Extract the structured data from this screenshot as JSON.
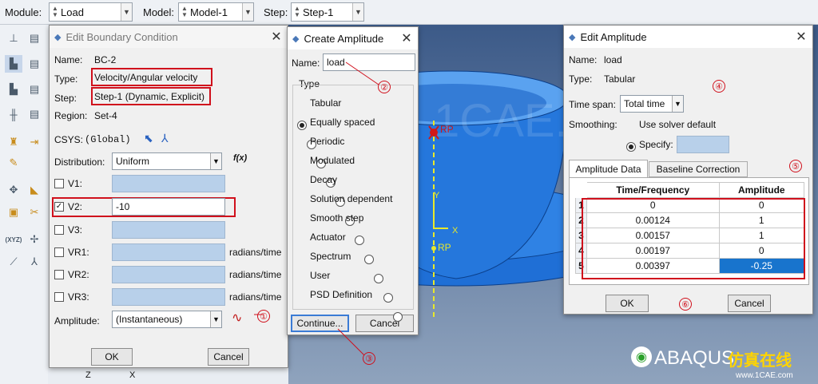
{
  "topbar": {
    "module_label": "Module:",
    "module_value": "Load",
    "model_label": "Model:",
    "model_value": "Model-1",
    "step_label": "Step:",
    "step_value": "Step-1"
  },
  "bc": {
    "title": "Edit Boundary Condition",
    "name_label": "Name:",
    "name": "BC-2",
    "type_label": "Type:",
    "type": "Velocity/Angular velocity",
    "step_label": "Step:",
    "step": "Step-1 (Dynamic, Explicit)",
    "region_label": "Region:",
    "region": "Set-4",
    "csys_label": "CSYS:",
    "csys": "(Global)",
    "distribution_label": "Distribution:",
    "distribution": "Uniform",
    "fx": "f(x)",
    "rows": [
      {
        "label": "V1:",
        "checked": false,
        "value": "",
        "unit": ""
      },
      {
        "label": "V2:",
        "checked": true,
        "value": "-10",
        "unit": ""
      },
      {
        "label": "V3:",
        "checked": false,
        "value": "",
        "unit": ""
      },
      {
        "label": "VR1:",
        "checked": false,
        "value": "",
        "unit": "radians/time"
      },
      {
        "label": "VR2:",
        "checked": false,
        "value": "",
        "unit": "radians/time"
      },
      {
        "label": "VR3:",
        "checked": false,
        "value": "",
        "unit": "radians/time"
      }
    ],
    "amplitude_label": "Amplitude:",
    "amplitude": "(Instantaneous)",
    "ok": "OK",
    "cancel": "Cancel"
  },
  "ca": {
    "title": "Create Amplitude",
    "name_label": "Name:",
    "name": "load",
    "type_label": "Type",
    "types": [
      "Tabular",
      "Equally spaced",
      "Periodic",
      "Modulated",
      "Decay",
      "Solution dependent",
      "Smooth step",
      "Actuator",
      "Spectrum",
      "User",
      "PSD Definition"
    ],
    "selected_type": "Tabular",
    "continue": "Continue...",
    "cancel": "Cancel"
  },
  "ea": {
    "title": "Edit Amplitude",
    "name_label": "Name:",
    "name": "load",
    "type_label": "Type:",
    "type": "Tabular",
    "timespan_label": "Time span:",
    "timespan": "Total time",
    "smoothing_label": "Smoothing:",
    "smoothing_option": "Use solver default",
    "specify_label": "Specify:",
    "tabs": [
      "Amplitude Data",
      "Baseline Correction"
    ],
    "col_time": "Time/Frequency",
    "col_amp": "Amplitude",
    "rows": [
      {
        "n": "1",
        "t": "0",
        "a": "0"
      },
      {
        "n": "2",
        "t": "0.00124",
        "a": "1"
      },
      {
        "n": "3",
        "t": "0.00157",
        "a": "1"
      },
      {
        "n": "4",
        "t": "0.00197",
        "a": "0"
      },
      {
        "n": "5",
        "t": "0.00397",
        "a": "-0.25"
      }
    ],
    "ok": "OK",
    "cancel": "Cancel"
  },
  "callouts": [
    "①",
    "②",
    "③",
    "④",
    "⑤",
    "⑥"
  ],
  "viewport": {
    "rp_label": "RP",
    "rp_label2": "RP",
    "x_axis": "X",
    "y_axis": "Y",
    "triad_z": "Z",
    "triad_x": "X",
    "watermark": "1CAE.COM",
    "brand": "ABAQUS",
    "brand_cn": "仿真在线",
    "brand_url": "www.1CAE.com"
  },
  "colors": {
    "highlight_red": "#d0101c",
    "part_blue": "#1f6fd6",
    "selection_blue": "#1874cd",
    "field_blue": "#b8d0ea"
  }
}
